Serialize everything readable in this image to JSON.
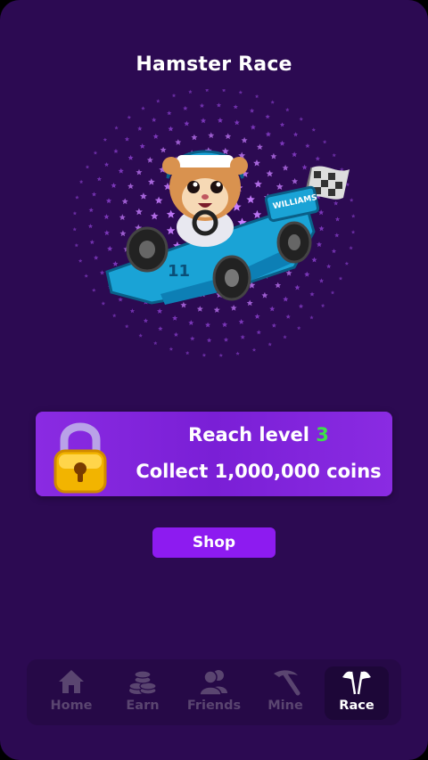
{
  "page": {
    "title": "Hamster Race"
  },
  "hero": {
    "image": "hamster-race-car-illustration",
    "car_brand_text": "WILLIAMS",
    "car_number": "11"
  },
  "lock_card": {
    "line1_prefix": "Reach level ",
    "level": "3",
    "line2": "Collect 1,000,000 coins",
    "icon": "padlock-icon",
    "level_color": "#3ee04a"
  },
  "shop_button": {
    "label": "Shop"
  },
  "bottom_nav": {
    "active": "Race",
    "items": [
      {
        "label": "Home",
        "icon": "home-icon"
      },
      {
        "label": "Earn",
        "icon": "coins-icon"
      },
      {
        "label": "Friends",
        "icon": "friends-icon"
      },
      {
        "label": "Mine",
        "icon": "pickaxe-icon"
      },
      {
        "label": "Race",
        "icon": "checkered-flags-icon"
      }
    ]
  },
  "colors": {
    "background": "#2c0a52",
    "card": "#8a2be2",
    "button": "#8d1bf0",
    "nav_inactive": "#5a4570"
  }
}
